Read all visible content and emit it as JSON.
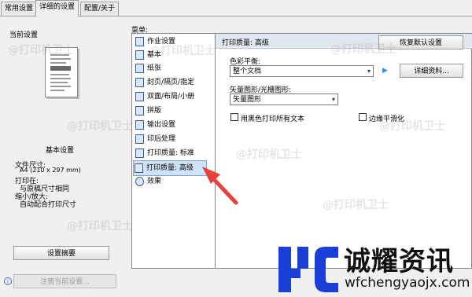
{
  "tabs": [
    {
      "label": "常用设置"
    },
    {
      "label": "详细的设置"
    },
    {
      "label": "配置/关于"
    }
  ],
  "left_panel": {
    "current_settings": "当前设置",
    "basic_settings": "基本设置",
    "paper_size_label": "文件尺寸:",
    "paper_size_value": "A4 (210 x 297 mm)",
    "print_to_label": "打印在:",
    "print_to_value": "与原稿尺寸相同",
    "scale_label": "缩小/放大:",
    "scale_value": "自动配合打印尺寸",
    "summary_button": "设置摘要",
    "register_button": "注册当前设置..."
  },
  "menu": {
    "label": "菜单:",
    "items": [
      {
        "label": "作业设置"
      },
      {
        "label": "基本"
      },
      {
        "label": "纸张"
      },
      {
        "label": "封页/隔页/指定"
      },
      {
        "label": "双面/布局/小册"
      },
      {
        "label": "拼版"
      },
      {
        "label": "输出设置"
      },
      {
        "label": "印后处理"
      },
      {
        "label": "打印质量: 标准"
      },
      {
        "label": "打印质量: 高级"
      },
      {
        "label": "效果"
      }
    ],
    "selected_index": 9
  },
  "content": {
    "title": "打印质量: 高级",
    "restore_button": "恢复默认设置",
    "color_balance_label": "色彩平衡:",
    "color_balance_value": "整个文档",
    "details_button": "详细资料...",
    "vector_label": "矢量图形/光栅图形:",
    "vector_value": "矢量图形",
    "black_text_label": "用黑色打印所有文本",
    "edge_smooth_label": "边缘平滑化",
    "black_text_checked": false,
    "edge_smooth_checked": false
  },
  "watermark": {
    "text": "@打印机卫士"
  },
  "brand": {
    "name": "诚耀资讯",
    "url": "wfchengyaojx.com",
    "logo_color": "#1a3fd6",
    "arrow_color": "#e8413a"
  }
}
